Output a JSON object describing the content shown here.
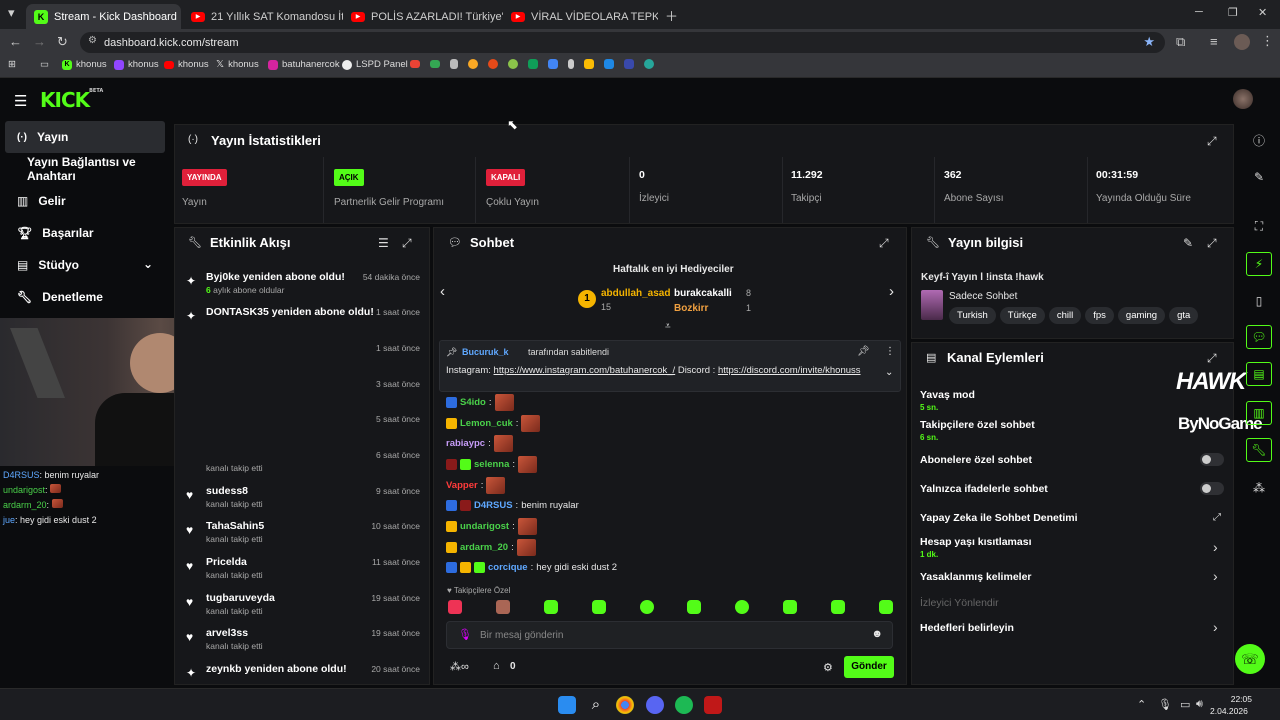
{
  "browser": {
    "tabs": [
      {
        "title": "Stream - Kick Dashboard",
        "icon": "kick-icon"
      },
      {
        "title": "21 Yıllık SAT Komandosu İtiraflar",
        "icon": "youtube-icon"
      },
      {
        "title": "POLİS AZARLADI! Türkiye'de Ya",
        "icon": "youtube-icon"
      },
      {
        "title": "VİRAL VİDEOLARA TEPKİ - You",
        "icon": "youtube-icon"
      }
    ],
    "url": "dashboard.kick.com/stream",
    "bookmarks": [
      "khonus",
      "khonus",
      "khonus",
      "khonus",
      "batuhanercok",
      "LSPD Panel"
    ]
  },
  "sidebar": {
    "items": [
      {
        "label": "Yayın",
        "icon": "broadcast-icon"
      },
      {
        "label": "Yayın Bağlantısı ve Anahtarı",
        "icon": ""
      },
      {
        "label": "Gelir",
        "icon": "chart-icon"
      },
      {
        "label": "Başarılar",
        "icon": "trophy-icon"
      },
      {
        "label": "Stüdyo",
        "icon": "studio-icon"
      },
      {
        "label": "Denetleme",
        "icon": "wrench-icon"
      }
    ]
  },
  "stats": {
    "title": "Yayın İstatistikleri",
    "cards": [
      {
        "badge": "YAYINDA",
        "badge_color": "#e0203a",
        "label": "Yayın"
      },
      {
        "badge": "AÇIK",
        "badge_color": "#53fc18",
        "label": "Partnerlik Gelir Programı"
      },
      {
        "badge": "KAPALI",
        "badge_color": "#e0203a",
        "label": "Çoklu Yayın"
      },
      {
        "value": "0",
        "label": "İzleyici"
      },
      {
        "value": "11.292",
        "label": "Takipçi"
      },
      {
        "value": "362",
        "label": "Abone Sayısı"
      },
      {
        "value": "00:31:59",
        "label": "Yayında Olduğu Süre"
      }
    ]
  },
  "activity": {
    "title": "Etkinlik Akışı",
    "events": [
      {
        "name": "Byj0ke yeniden abone oldu!",
        "sub": "aylık abone oldular",
        "sub_prefix": "6",
        "time": "54 dakika önce"
      },
      {
        "name": "DONTASK35 yeniden abone oldu!",
        "sub": "",
        "time": "1 saat önce"
      },
      {
        "name": "",
        "sub": "",
        "time": "1 saat önce"
      },
      {
        "name": "",
        "sub": "",
        "time": "3 saat önce"
      },
      {
        "name": "",
        "sub": "",
        "time": "5 saat önce"
      },
      {
        "name": "",
        "sub": "kanalı takip etti",
        "time": "6 saat önce"
      },
      {
        "name": "sudess8",
        "sub": "kanalı takip etti",
        "time": "9 saat önce"
      },
      {
        "name": "TahaSahin5",
        "sub": "kanalı takip etti",
        "time": "10 saat önce"
      },
      {
        "name": "Pricelda",
        "sub": "kanalı takip etti",
        "time": "11 saat önce"
      },
      {
        "name": "tugbaruveyda",
        "sub": "kanalı takip etti",
        "time": "19 saat önce"
      },
      {
        "name": "arvel3ss",
        "sub": "kanalı takip etti",
        "time": "19 saat önce"
      },
      {
        "name": "zeynkb yeniden abone oldu!",
        "sub": "",
        "time": "20 saat önce"
      }
    ]
  },
  "chat": {
    "title": "Sohbet",
    "gifters_title": "Haftalık en iyi Hediyeciler",
    "gifters": [
      {
        "name": "abdullah_asad",
        "count": "15"
      },
      {
        "name": "burakcakalli",
        "count": "8"
      },
      {
        "name": "Bozkirr",
        "count": "1"
      }
    ],
    "pinned_by": "Bucuruk_k",
    "pinned_suffix": "tarafından sabitlendi",
    "pinned_text_prefix": "Instagram:",
    "pinned_link1": "https://www.instagram.com/batuhanercok_/",
    "pinned_mid": "Discord :",
    "pinned_link2": "https://discord.com/invite/khonuss",
    "messages": [
      {
        "user": "S4ido",
        "color": "#4ad14a",
        "text": ""
      },
      {
        "user": "Lemon_cuk",
        "color": "#4ad14a",
        "text": ""
      },
      {
        "user": "rabiaypc",
        "color": "#c69cf7",
        "text": ""
      },
      {
        "user": "selenna",
        "color": "#4ad14a",
        "text": ""
      },
      {
        "user": "Vapper",
        "color": "#ff3b3b",
        "text": ""
      },
      {
        "user": "D4RSUS",
        "color": "#5fa8ff",
        "text": "benim ruyalar"
      },
      {
        "user": "undarigost",
        "color": "#4ad14a",
        "text": ""
      },
      {
        "user": "ardarm_20",
        "color": "#4ad14a",
        "text": ""
      },
      {
        "user": "corcique",
        "color": "#5fa8ff",
        "text": "hey gidi eski dust 2"
      }
    ],
    "followers_only": "Takipçilere Özel",
    "input_placeholder": "Bir mesaj gönderin",
    "points": "0",
    "send_label": "Gönder"
  },
  "stream_info": {
    "title": "Yayın bilgisi",
    "stream_title": "Keyf-î Yayın l !insta !hawk",
    "category": "Sadece Sohbet",
    "tags": [
      "Turkish",
      "Türkçe",
      "chill",
      "fps",
      "gaming",
      "gta"
    ]
  },
  "channel_actions": {
    "title": "Kanal Eylemleri",
    "items": [
      {
        "label": "Yavaş mod",
        "sub": "5 sn."
      },
      {
        "label": "Takipçilere özel sohbet",
        "sub": "6 sn."
      },
      {
        "label": "Abonelere özel sohbet",
        "sub": ""
      },
      {
        "label": "Yalnızca ifadelerle sohbet",
        "sub": ""
      },
      {
        "label": "Yapay Zeka ile Sohbet Denetimi",
        "sub": ""
      },
      {
        "label": "Hesap yaşı kısıtlaması",
        "sub": "1 dk."
      },
      {
        "label": "Yasaklanmış kelimeler",
        "sub": ""
      },
      {
        "label": "İzleyici Yönlendir",
        "sub": ""
      },
      {
        "label": "Hedefleri belirleyin",
        "sub": ""
      }
    ]
  },
  "overlay": {
    "chat": [
      {
        "user": "D4RSUS",
        "text": "benim ruyalar"
      },
      {
        "user": "undarigost",
        "text": ""
      },
      {
        "user": "ardarm_20",
        "text": ""
      },
      {
        "user": "jue",
        "text": "hey gidi eski dust 2"
      }
    ],
    "sponsor1": "HAWK",
    "sponsor2": "ByNoGame"
  },
  "taskbar": {
    "time": "22:05",
    "date": "2.04.2026"
  },
  "colors": {
    "accent": "#53fc18",
    "live": "#e0203a"
  }
}
